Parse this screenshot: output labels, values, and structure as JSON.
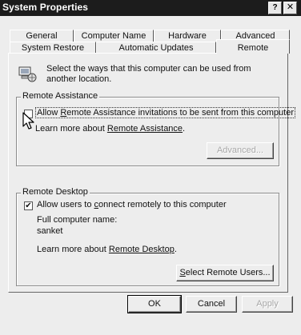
{
  "window": {
    "title": "System Properties",
    "help_label": "?",
    "close_label": "✕"
  },
  "tabs": {
    "back_row": [
      "General",
      "Computer Name",
      "Hardware",
      "Advanced"
    ],
    "front_row": [
      "System Restore",
      "Automatic Updates",
      "Remote"
    ],
    "active": "Remote"
  },
  "intro": {
    "icon": "computer-network-icon",
    "text": "Select the ways that this computer can be used from another location."
  },
  "remote_assistance": {
    "group_label": "Remote Assistance",
    "checkbox_label_pre": "Allow ",
    "checkbox_label_hotkey": "R",
    "checkbox_label_post": "emote Assistance invitations to be sent from this computer",
    "checked": false,
    "learn_more_pre": "Learn more about ",
    "learn_more_link": "Remote Assistance",
    "learn_more_post": ".",
    "advanced_button": "Advanced..."
  },
  "remote_desktop": {
    "group_label": "Remote Desktop",
    "checkbox_label_pre": "Allow users to ",
    "checkbox_label_hotkey": "c",
    "checkbox_label_post": "onnect remotely to this computer",
    "checked": true,
    "check_mark": "✔",
    "full_name_label": "Full computer name:",
    "full_name_value": "sanket",
    "learn_more_pre": "Learn more about ",
    "learn_more_link": "Remote Desktop",
    "learn_more_post": ".",
    "select_users_hotkey": "S",
    "select_users_rest": "elect Remote Users..."
  },
  "footer": {
    "ok": "OK",
    "cancel": "Cancel",
    "apply": "Apply"
  }
}
